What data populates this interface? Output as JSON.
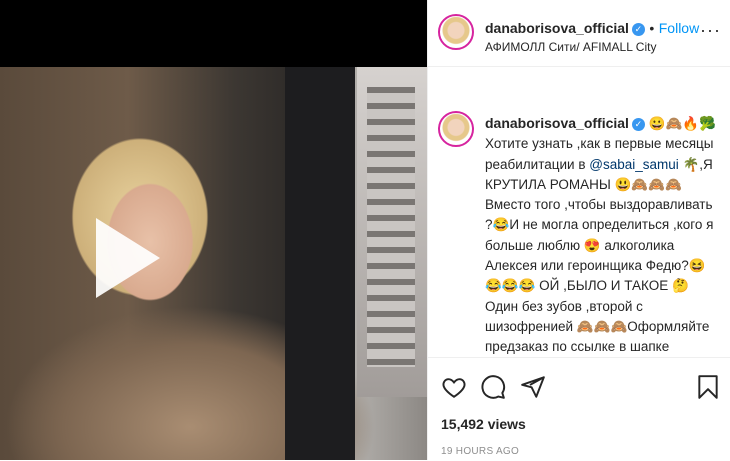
{
  "header": {
    "username": "danaborisova_official",
    "separator": "•",
    "follow_label": "Follow",
    "location": "АФИМОЛЛ Сити/ AFIMALL City",
    "more_label": "···"
  },
  "caption": {
    "username": "danaborisova_official",
    "inline_emojis": "😀🙈🔥🥦",
    "text_part1": "Хотите узнать ,как в первые месяцы реабилитации в ",
    "mention": "@sabai_samui",
    "text_part2": " 🌴,Я КРУТИЛА РОМАНЫ 😃🙈🙈🙈 Вместо того ,чтобы выздоравливать ?😂И не могла определиться ,кого я больше люблю 😍 алкоголика Алексея или героинщика Федю?😆 😂😂😂 ОЙ ,БЫЛО И ТАКОЕ 🤔 Один без зубов ,второй с шизофренией 🙈🙈🙈Оформляйте предзаказ по ссылке в шапке"
  },
  "footer": {
    "views": "15,492 views",
    "timestamp": "19 HOURS AGO"
  },
  "icons": {
    "like": "heart-icon",
    "comment": "comment-icon",
    "share": "share-icon",
    "save": "bookmark-icon",
    "play": "play-icon"
  },
  "colors": {
    "link": "#0095f6",
    "verified": "#3897f0",
    "meta": "#8e8e8e"
  }
}
